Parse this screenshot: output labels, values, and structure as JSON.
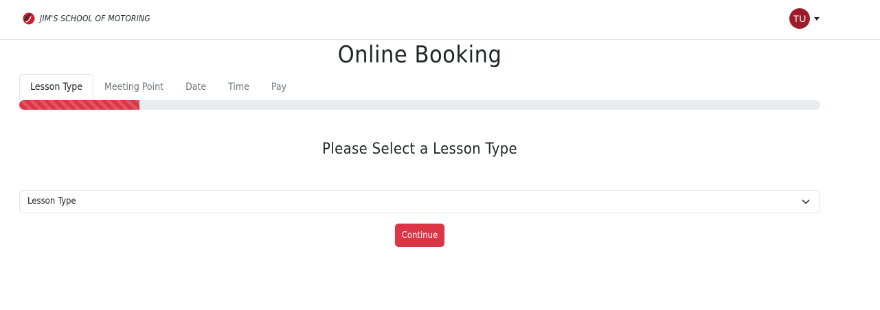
{
  "brand": {
    "name": "JIM'S SCHOOL OF MOTORING",
    "logo_icon": "speed-swoosh-logo"
  },
  "user": {
    "initials": "TU",
    "avatar_color": "#9d1c2a"
  },
  "page": {
    "title": "Online Booking"
  },
  "tabs": [
    {
      "label": "Lesson Type",
      "active": true
    },
    {
      "label": "Meeting Point",
      "active": false
    },
    {
      "label": "Date",
      "active": false
    },
    {
      "label": "Time",
      "active": false
    },
    {
      "label": "Pay",
      "active": false
    }
  ],
  "progress": {
    "fraction": 0.15,
    "color": "#dc3545"
  },
  "form": {
    "heading": "Please Select a Lesson Type",
    "select_value": "Lesson Type",
    "continue_label": "Continue",
    "accent_color": "#dc3545"
  }
}
